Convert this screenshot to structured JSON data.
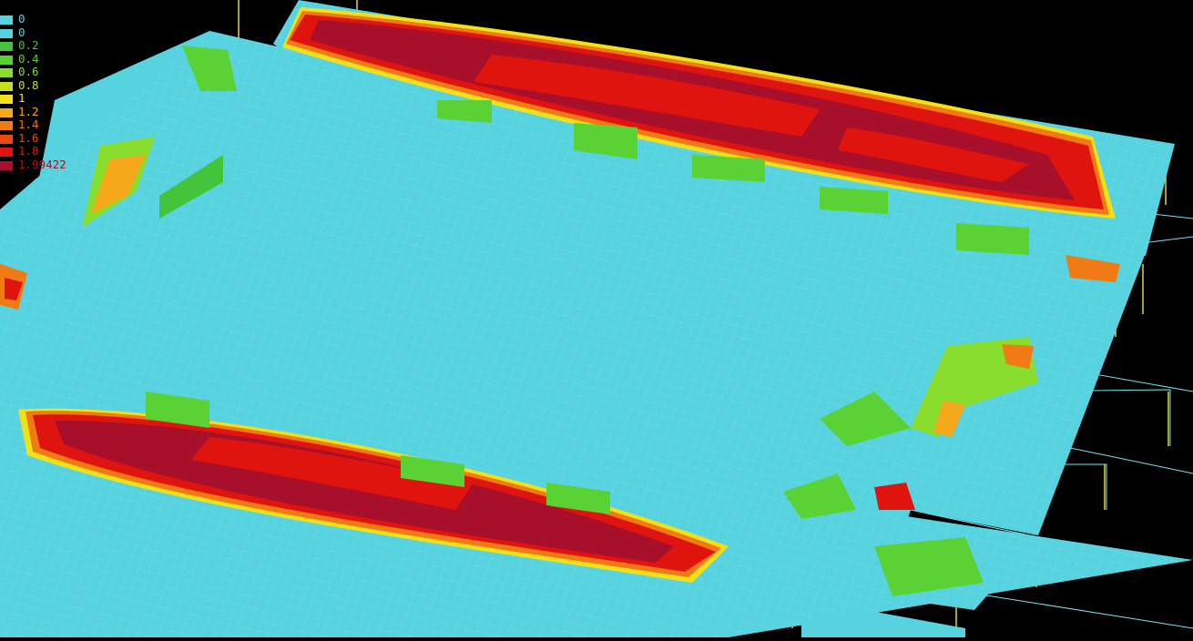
{
  "legend": {
    "items": [
      {
        "label": "0",
        "color": "#57d3e0"
      },
      {
        "label": "0",
        "color": "#57d3e0"
      },
      {
        "label": "0.2",
        "color": "#44c43b"
      },
      {
        "label": "0.4",
        "color": "#5ad233"
      },
      {
        "label": "0.6",
        "color": "#89dd2c"
      },
      {
        "label": "0.8",
        "color": "#c5e01e"
      },
      {
        "label": "1",
        "color": "#f2e01a"
      },
      {
        "label": "1.2",
        "color": "#f5a81a"
      },
      {
        "label": "1.4",
        "color": "#f07a14"
      },
      {
        "label": "1.6",
        "color": "#ea4a12"
      },
      {
        "label": "1.8",
        "color": "#e0140e"
      },
      {
        "label": "1.99422",
        "color": "#a80f2a"
      }
    ]
  },
  "colors": {
    "background": "#000000",
    "slab": "#57d3e0",
    "mesh": "#8fe4ee",
    "column": "#f2e34a",
    "beam": "#79e3ee"
  }
}
